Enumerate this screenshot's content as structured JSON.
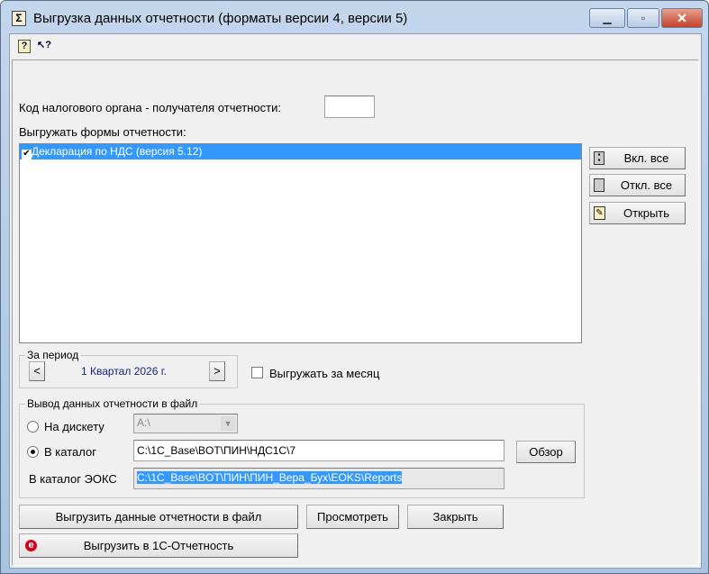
{
  "window": {
    "title": "Выгрузка данных отчетности (форматы версии 4, версии 5)",
    "minimize": "▁",
    "maximize": "▫",
    "close": "✕"
  },
  "toolbar": {
    "help_icon": "?",
    "whats_this_icon": "↖?"
  },
  "tax_code": {
    "label": "Код налогового органа - получателя отчетности:",
    "value": ""
  },
  "forms": {
    "label": "Выгружать формы отчетности:",
    "items": [
      {
        "label": "Декларация по НДС (версия 5.12)",
        "checked": true,
        "selected": true
      }
    ]
  },
  "side_buttons": {
    "enable_all": "Вкл. все",
    "disable_all": "Откл. все",
    "open": "Открыть"
  },
  "period": {
    "legend": "За период",
    "prev": "<",
    "next": ">",
    "value": "1 Квартал 2026 г.",
    "monthly_label": "Выгружать за месяц",
    "monthly_checked": false
  },
  "output": {
    "legend": "Вывод данных отчетности в файл",
    "floppy_label": "На дискету",
    "floppy_value": "A:\\",
    "catalog_label": "В каталог",
    "catalog_value": "C:\\1C_Base\\BOT\\ПИН\\НДС1С\\7",
    "browse": "Обзор",
    "eoks_label": "В каталог ЭОКС",
    "eoks_value": "C:\\1C_Base\\BOT\\ПИН\\ПИН_Вера_Бух\\EOKS\\Reports",
    "selected": "catalog"
  },
  "actions": {
    "export_file": "Выгрузить данные отчетности в файл",
    "preview": "Просмотреть",
    "close": "Закрыть",
    "export_1c": "Выгрузить в 1С-Отчетность",
    "export_1c_icon": "e"
  },
  "colors": {
    "selection": "#3399ff",
    "period_text": "#1a237e",
    "accent_red": "#d0021b"
  }
}
